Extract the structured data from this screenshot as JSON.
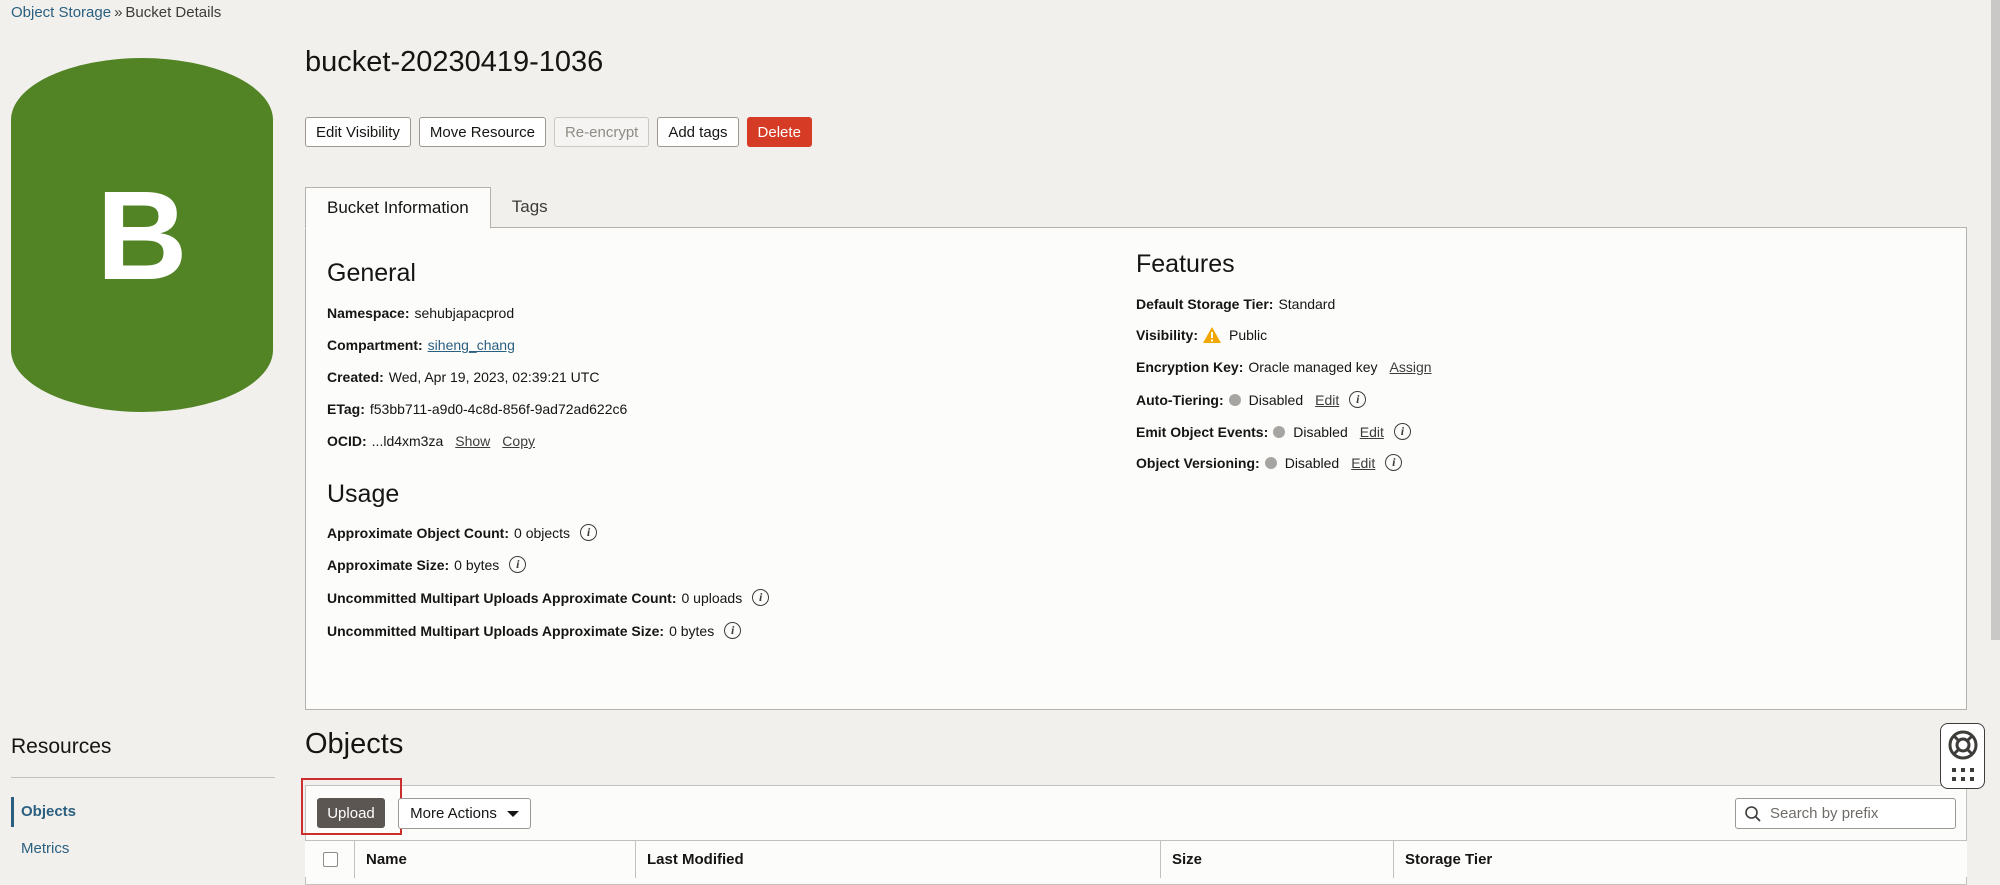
{
  "breadcrumb": {
    "root": "Object Storage",
    "separator": "»",
    "current": "Bucket Details"
  },
  "bucket_icon": {
    "letter": "B",
    "color": "#528425"
  },
  "title": "bucket-20230419-1036",
  "actions": {
    "edit_visibility": "Edit Visibility",
    "move_resource": "Move Resource",
    "re_encrypt": "Re-encrypt",
    "add_tags": "Add tags",
    "delete": "Delete"
  },
  "tabs": {
    "bucket_info": "Bucket Information",
    "tags": "Tags"
  },
  "general": {
    "heading": "General",
    "namespace_k": "Namespace:",
    "namespace_v": "sehubjapacprod",
    "compartment_k": "Compartment:",
    "compartment_v": "siheng_chang",
    "created_k": "Created:",
    "created_v": "Wed, Apr 19, 2023, 02:39:21 UTC",
    "etag_k": "ETag:",
    "etag_v": "f53bb711-a9d0-4c8d-856f-9ad72ad622c6",
    "ocid_k": "OCID:",
    "ocid_v": "...ld4xm3za",
    "ocid_show": "Show",
    "ocid_copy": "Copy"
  },
  "usage": {
    "heading": "Usage",
    "count_k": "Approximate Object Count:",
    "count_v": "0 objects",
    "size_k": "Approximate Size:",
    "size_v": "0 bytes",
    "mp_count_k": "Uncommitted Multipart Uploads Approximate Count:",
    "mp_count_v": "0 uploads",
    "mp_size_k": "Uncommitted Multipart Uploads Approximate Size:",
    "mp_size_v": "0 bytes"
  },
  "features": {
    "heading": "Features",
    "tier_k": "Default Storage Tier:",
    "tier_v": "Standard",
    "visibility_k": "Visibility:",
    "visibility_v": "Public",
    "encryption_k": "Encryption Key:",
    "encryption_v": "Oracle managed key",
    "encryption_action": "Assign",
    "autotier_k": "Auto-Tiering:",
    "autotier_v": "Disabled",
    "events_k": "Emit Object Events:",
    "events_v": "Disabled",
    "versioning_k": "Object Versioning:",
    "versioning_v": "Disabled",
    "edit_label": "Edit"
  },
  "resources": {
    "heading": "Resources",
    "items": [
      "Objects",
      "Metrics"
    ]
  },
  "objects": {
    "heading": "Objects",
    "upload": "Upload",
    "more_actions": "More Actions",
    "search_placeholder": "Search by prefix",
    "columns": [
      "Name",
      "Last Modified",
      "Size",
      "Storage Tier"
    ]
  },
  "colors": {
    "accent": "#2b5f80",
    "danger": "#d63b25",
    "warning": "#f0a800",
    "highlight": "#cc2e2e"
  }
}
